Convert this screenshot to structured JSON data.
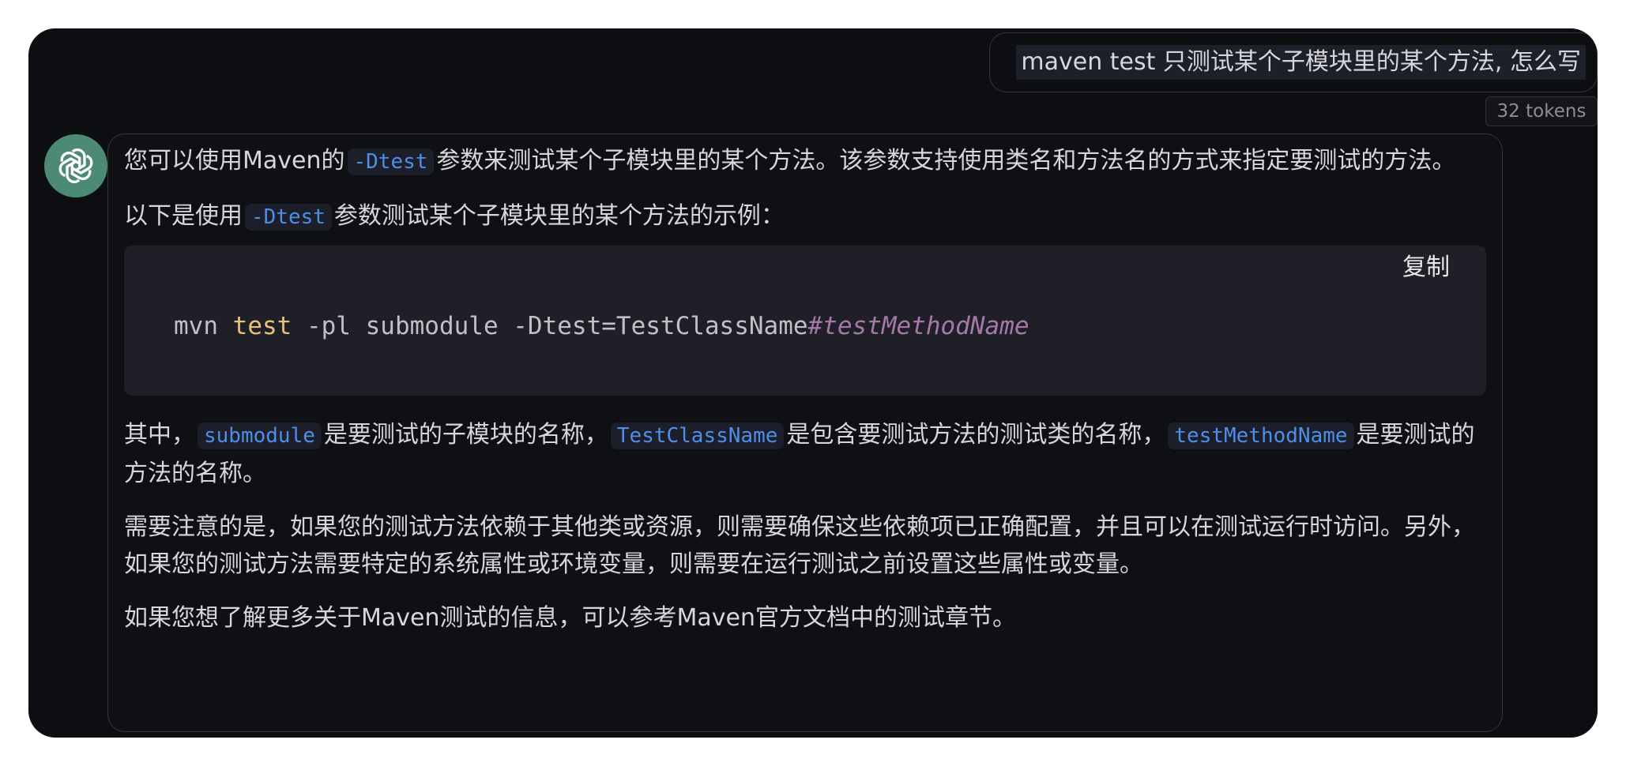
{
  "user_message": {
    "text": "maven test 只测试某个子模块里的某个方法, 怎么写",
    "tokens": "32 tokens"
  },
  "assistant": {
    "avatar_icon": "openai-logo-icon",
    "p1": {
      "a": "您可以使用Maven的",
      "code": "-Dtest",
      "b": "参数来测试某个子模块里的某个方法。该参数支持使用类名和方法名的方式来指定要测试的方法。"
    },
    "p2": {
      "a": "以下是使用",
      "code": "-Dtest",
      "b": "参数测试某个子模块里的某个方法的示例："
    },
    "code_block": {
      "copy_label": "复制",
      "tokens": {
        "cmd": "mvn ",
        "kw": "test",
        "args": " -pl submodule -Dtest=TestClassName",
        "comment": "#testMethodName"
      }
    },
    "p3": {
      "a": "其中，",
      "code1": "submodule",
      "b": "是要测试的子模块的名称，",
      "code2": "TestClassName",
      "c": "是包含要测试方法的测试类的名称，",
      "code3": "testMethodName",
      "d": "是要测试的方法的名称。"
    },
    "p4": "需要注意的是，如果您的测试方法依赖于其他类或资源，则需要确保这些依赖项已正确配置，并且可以在测试运行时访问。另外，如果您的测试方法需要特定的系统属性或环境变量，则需要在运行测试之前设置这些属性或变量。",
    "p5": "如果您想了解更多关于Maven测试的信息，可以参考Maven官方文档中的测试章节。"
  },
  "colors": {
    "background": "#0d0e11",
    "avatar": "#4c8a74",
    "inline_code": "#4d8fe8",
    "keyword": "#e7c07b",
    "comment": "#a678a8"
  }
}
